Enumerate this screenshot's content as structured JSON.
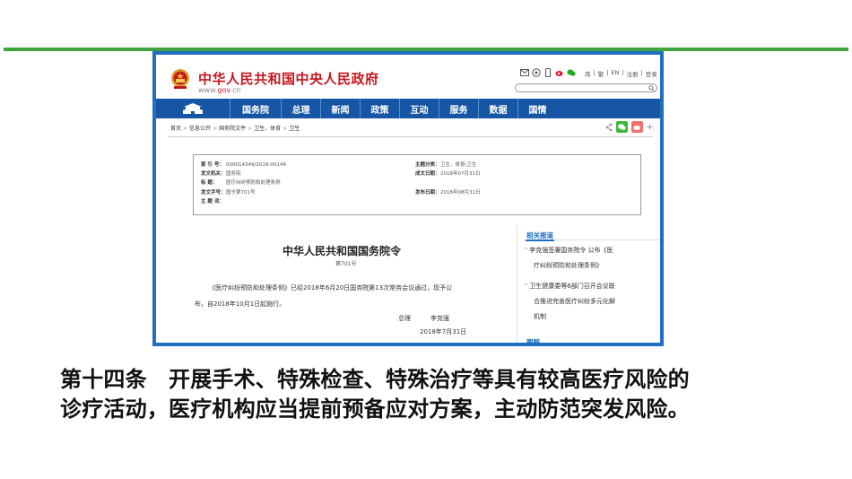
{
  "site": {
    "title": "中华人民共和国中央人民政府",
    "url_prefix": "www.",
    "url_domain": "gov",
    "url_suffix": ".cn",
    "links": [
      "简",
      "|",
      "繁",
      "|",
      "EN",
      "|",
      "注册",
      "|",
      "登录"
    ]
  },
  "nav": {
    "items": [
      "国务院",
      "总理",
      "新闻",
      "政策",
      "互动",
      "服务",
      "数据",
      "国情"
    ]
  },
  "breadcrumb": {
    "items": [
      "首页",
      "信息公开",
      "国务院文件",
      "卫生、体育",
      "卫生"
    ]
  },
  "meta": {
    "index_label": "索 引 号：",
    "index_value": "000014349/2018-00149",
    "topic_label": "主题分类：",
    "topic_value": "卫生、体育\\卫生",
    "issuer_label": "发文机关：",
    "issuer_value": "国务院",
    "written_label": "成文日期：",
    "written_value": "2018年07月31日",
    "subject_label": "标      题：",
    "subject_value": "医疗纠纷预防和处理条例",
    "docno_label": "发文字号：",
    "docno_value": "国令第701号",
    "published_label": "发布日期：",
    "published_value": "2018年08月31日",
    "keywords_label": "主 题 词："
  },
  "article": {
    "title": "中华人民共和国国务院令",
    "number": "第701号",
    "line1": "《医疗纠纷预防和处理条例》已经2018年6月20日国务院第13次常务会议通过，现予公",
    "line2": "布，自2018年10月1日起施行。",
    "signer_title": "总理",
    "signer_name": "李克强",
    "date": "2018年7月31日"
  },
  "sidebar": {
    "title": "相关报道",
    "items": [
      "李克强签署国务院令 公布《医",
      "疗纠纷预防和处理条例》",
      "卫生健康委等6部门召开会议联",
      "合推进完善医疗纠纷多元化解",
      "机制"
    ],
    "title2": "图解"
  },
  "caption": {
    "line1": "第十四条　开展手术、特殊检查、特殊治疗等具有较高医疗风险的",
    "line2": "诊疗活动，医疗机构应当提前预备应对方案，主动防范突发风险。"
  },
  "colors": {
    "accent_green": "#3fa33f",
    "frame_blue": "#1e6fc0",
    "nav_blue": "#1656a4",
    "brand_red": "#c8161d"
  }
}
